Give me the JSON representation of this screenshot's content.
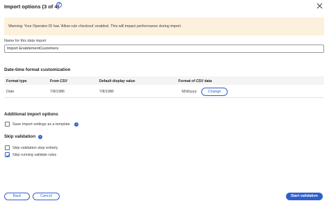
{
  "dialog": {
    "title": "Import options (3 of 4)",
    "help_glyph": "?",
    "close_icon": "close-icon"
  },
  "warning": {
    "text": "Warning:  Your Operator ID has 'Allow rule checkout' enabled. This will impact performance during import.",
    "background": "#fdf1dd"
  },
  "name_field": {
    "label": "Name for this data import",
    "value": "Import EnablementCustomers"
  },
  "datetime": {
    "heading": "Date-time format customization",
    "columns": [
      "Format type",
      "From CSV",
      "Default display value",
      "Format of CSV data"
    ],
    "rows": [
      {
        "format_type": "Date",
        "from_csv": "7/8/1986",
        "default_display": "7/8/1986",
        "csv_format": "M/d/yyyy",
        "action": "Change"
      }
    ]
  },
  "additional": {
    "heading": "Additional import options",
    "save_template_label": "Save import settings as a template",
    "save_template_checked": false
  },
  "skip_validation": {
    "heading": "Skip validation",
    "options": [
      {
        "label": "Skip validation step entirely",
        "checked": false
      },
      {
        "label": "Skip running validate rules",
        "checked": true
      }
    ]
  },
  "footer": {
    "back_label": "Back",
    "cancel_label": "Cancel",
    "primary_label": "Start validation"
  },
  "colors": {
    "accent": "#2f5fd0",
    "text": "#1f1f1f"
  }
}
